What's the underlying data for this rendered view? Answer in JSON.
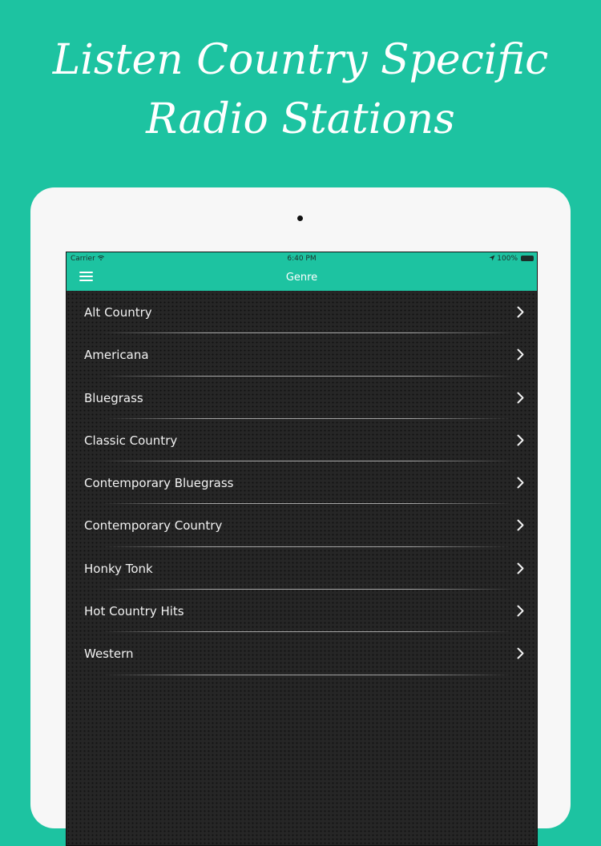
{
  "promo": {
    "line1": "Listen Country Specific",
    "line2": "Radio Stations"
  },
  "status_bar": {
    "carrier": "Carrier",
    "time": "6:40 PM",
    "battery": "100%"
  },
  "nav": {
    "title": "Genre",
    "menu_icon": "hamburger-icon"
  },
  "genres": [
    "Alt Country",
    "Americana",
    "Bluegrass",
    "Classic Country",
    "Contemporary Bluegrass",
    "Contemporary Country",
    "Honky Tonk",
    "Hot Country Hits",
    "Western"
  ],
  "colors": {
    "accent": "#1dc3a1",
    "list_background": "#262626",
    "text": "#f2f2f2"
  }
}
